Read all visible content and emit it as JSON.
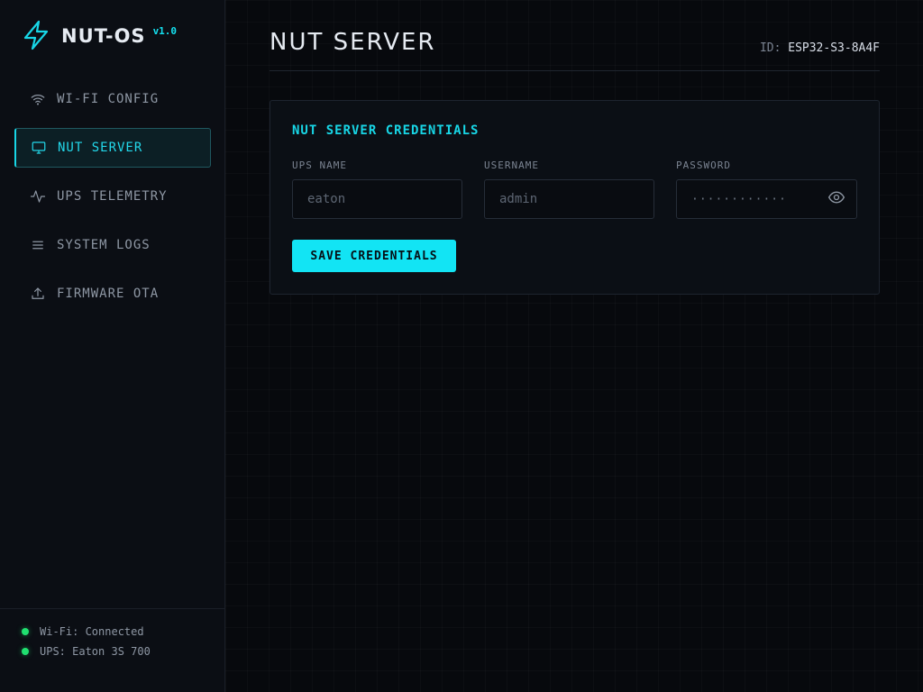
{
  "brand": {
    "name": "NUT-OS",
    "version": "v1.0"
  },
  "nav": {
    "items": [
      {
        "label": "WI-FI CONFIG",
        "icon": "wifi-icon",
        "active": false
      },
      {
        "label": "NUT SERVER",
        "icon": "monitor-icon",
        "active": true
      },
      {
        "label": "UPS TELEMETRY",
        "icon": "activity-icon",
        "active": false
      },
      {
        "label": "SYSTEM LOGS",
        "icon": "list-icon",
        "active": false
      },
      {
        "label": "FIRMWARE OTA",
        "icon": "upload-icon",
        "active": false
      }
    ]
  },
  "status": {
    "wifi": "Wi-Fi: Connected",
    "ups": "UPS: Eaton 3S 700",
    "color": "#20e070"
  },
  "header": {
    "title": "NUT SERVER",
    "id_label": "ID:",
    "id_value": "ESP32-S3-8A4F"
  },
  "card": {
    "title": "NUT SERVER CREDENTIALS",
    "fields": {
      "ups_name": {
        "label": "UPS NAME",
        "placeholder": "eaton"
      },
      "username": {
        "label": "USERNAME",
        "placeholder": "admin"
      },
      "password": {
        "label": "PASSWORD",
        "value": "············"
      }
    },
    "save_label": "SAVE CREDENTIALS"
  },
  "colors": {
    "accent": "#12e4f4",
    "background": "#07090d",
    "panel": "#0b0f15"
  }
}
